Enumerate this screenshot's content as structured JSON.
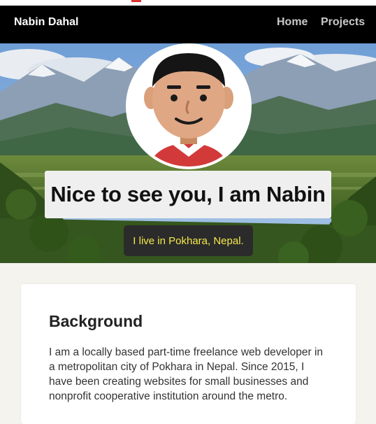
{
  "nav": {
    "brand": "Nabin Dahal",
    "links": [
      "Home",
      "Projects"
    ]
  },
  "hero": {
    "greeting": "Nice to see you, I am Nabin",
    "location": "I live in Pokhara, Nepal."
  },
  "background": {
    "title": "Background",
    "text": "I am a locally based part-time freelance web developer in a metropolitan city of Pokhara in Nepal. Since 2015, I have been creating websites for small businesses and nonprofit cooperative institution around the metro."
  },
  "colors": {
    "nav_bg": "#000000",
    "location_text": "#f5e94a",
    "page_bg": "#f4f3ee"
  }
}
